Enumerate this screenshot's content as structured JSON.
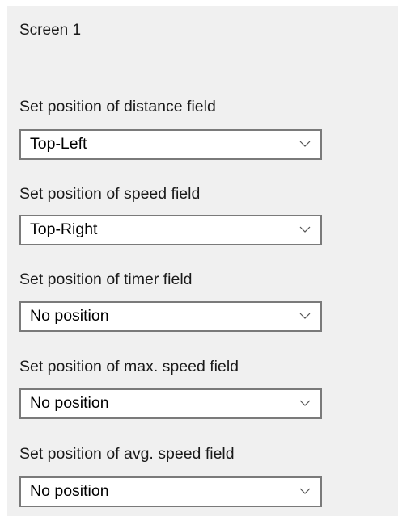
{
  "screen": {
    "title": "Screen 1"
  },
  "fields": [
    {
      "label": "Set position of distance field",
      "value": "Top-Left"
    },
    {
      "label": "Set position of speed field",
      "value": "Top-Right"
    },
    {
      "label": "Set position of timer field",
      "value": "No position"
    },
    {
      "label": "Set position of max. speed field",
      "value": "No position"
    },
    {
      "label": "Set position of avg. speed field",
      "value": "No position"
    }
  ],
  "icons": {
    "dropdown_arrow": "chevron-down-icon"
  },
  "colors": {
    "panel_background": "#f0f0f0",
    "dropdown_border": "#7a7a7a",
    "dropdown_background": "#ffffff",
    "text": "#1a1a1a"
  }
}
